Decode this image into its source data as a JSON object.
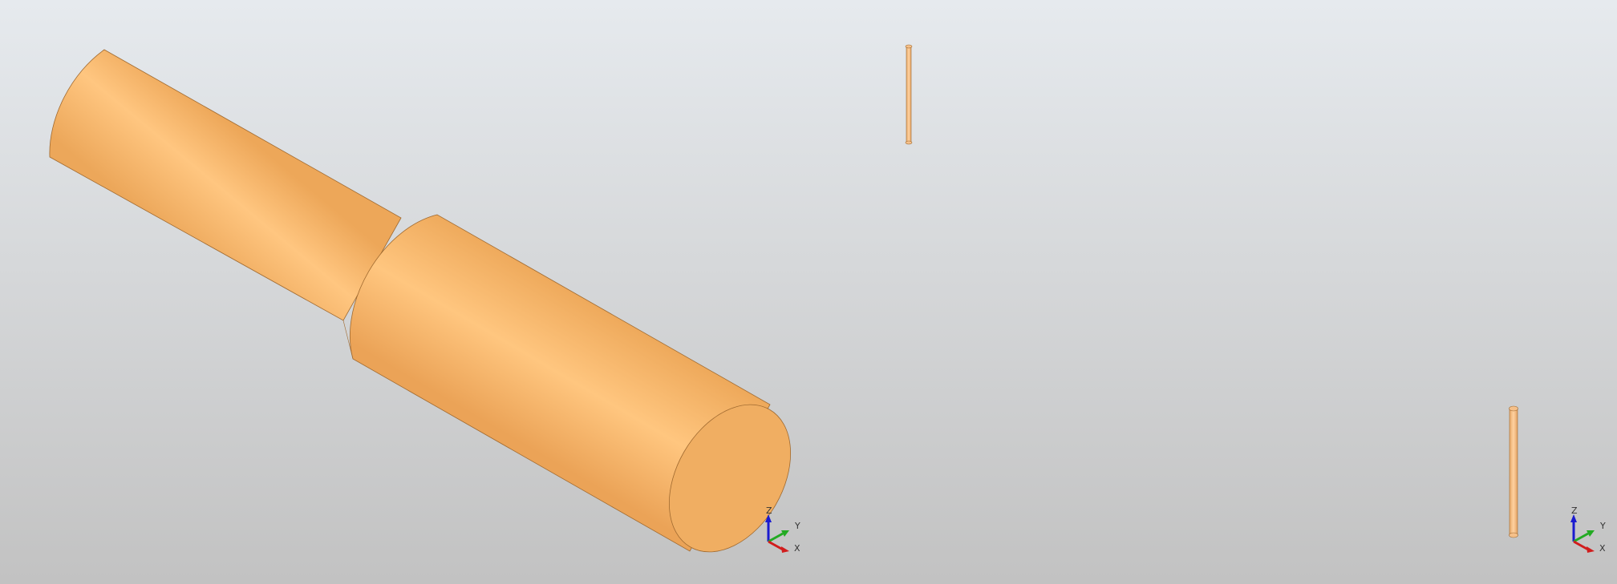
{
  "viewports": [
    {
      "id": "left",
      "triad": {
        "z_label": "Z",
        "y_label": "Y",
        "x_label": "X"
      }
    },
    {
      "id": "right",
      "triad": {
        "z_label": "Z",
        "y_label": "Y",
        "x_label": "X"
      }
    }
  ],
  "colors": {
    "part_light": "#ffc680",
    "part_mid": "#f4b46a",
    "part_dark": "#e8a357",
    "axis_x": "#d11c1c",
    "axis_y": "#22aa22",
    "axis_z": "#1a1ad0"
  }
}
